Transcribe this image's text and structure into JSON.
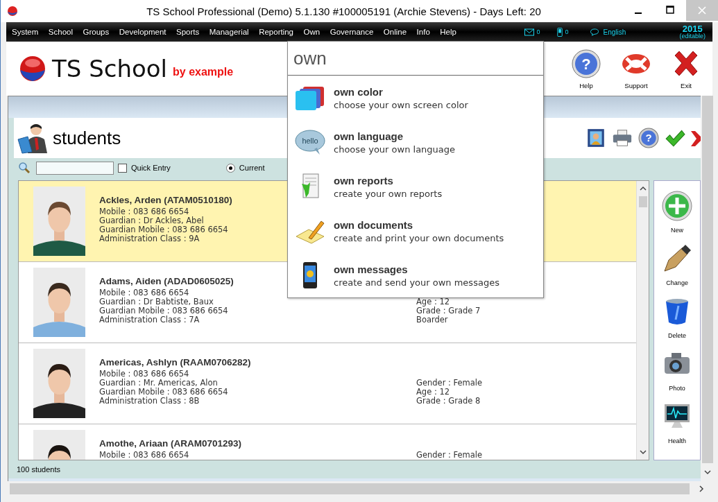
{
  "window": {
    "title": "TS School Professional (Demo) 5.1.130 #100005191 (Archie Stevens) - Days Left: 20"
  },
  "menu": [
    "System",
    "School",
    "Groups",
    "Development",
    "Sports",
    "Managerial",
    "Reporting",
    "Own",
    "Governance",
    "Online",
    "Info",
    "Help"
  ],
  "indicators": {
    "mail_count": "0",
    "sms_count": "0",
    "language": "English",
    "year": "2015",
    "year_note": "(editable)"
  },
  "logo": {
    "name": "TS School",
    "tagline": "by example"
  },
  "header_buttons": [
    {
      "kind": "help",
      "label": "Help",
      "glyph": "?"
    },
    {
      "kind": "support",
      "label": "Support"
    },
    {
      "kind": "exit",
      "label": "Exit"
    }
  ],
  "search_popup": {
    "query": "own",
    "items": [
      {
        "kind": "color",
        "title": "own color",
        "description": "choose your own screen color"
      },
      {
        "kind": "language",
        "title": "own language",
        "description": "choose your own language",
        "glyph": "hello"
      },
      {
        "kind": "reports",
        "title": "own reports",
        "description": "create your own reports"
      },
      {
        "kind": "documents",
        "title": "own documents",
        "description": "create and print your own documents"
      },
      {
        "kind": "messages",
        "title": "own messages",
        "description": "create and send your own messages"
      }
    ]
  },
  "module": {
    "title": "students",
    "toolbar": [
      {
        "kind": "portrait"
      },
      {
        "kind": "print"
      },
      {
        "kind": "help",
        "glyph": "?"
      },
      {
        "kind": "accept"
      },
      {
        "kind": "cancel"
      }
    ],
    "quick_entry": {
      "label": "Quick Entry",
      "checked": false
    },
    "current": {
      "label": "Current",
      "selected": true
    }
  },
  "students": [
    {
      "name": "Ackles, Arden (ATAM0510180)",
      "selected": true,
      "details": [
        "Mobile : 083 686 6654",
        "Guardian : Dr Ackles, Abel",
        "Guardian Mobile : 083 686 6654",
        "Administration Class : 9A"
      ]
    },
    {
      "name": "Adams, Aiden (ADAD0605025)",
      "selected": false,
      "details": [
        "Mobile : 083 686 6654",
        "Guardian : Dr Babtiste, Baux",
        "Guardian Mobile : 083 686 6654",
        "Administration Class : 7A"
      ],
      "extra": [
        "Age : 12",
        "Grade : Grade 7",
        "Boarder"
      ]
    },
    {
      "name": "Americas, Ashlyn (RAAM0706282)",
      "selected": false,
      "details": [
        "Mobile : 083 686 6654",
        "Guardian : Mr. Americas, Alon",
        "Guardian Mobile : 083 686 6654",
        "Administration Class : 8B"
      ],
      "extra": [
        "Gender : Female",
        "Age : 12",
        "Grade : Grade 8"
      ]
    },
    {
      "name": "Amothe, Ariaan (ARAM0701293)",
      "selected": false,
      "details": [
        "Mobile : 083 686 6654"
      ],
      "extra": [
        "Gender : Female"
      ]
    }
  ],
  "actions": [
    {
      "kind": "new",
      "label": "New"
    },
    {
      "kind": "change",
      "label": "Change"
    },
    {
      "kind": "delete",
      "label": "Delete"
    },
    {
      "label": "Photo"
    },
    {
      "kind": "health",
      "label": "Health"
    }
  ],
  "status": "100 students"
}
